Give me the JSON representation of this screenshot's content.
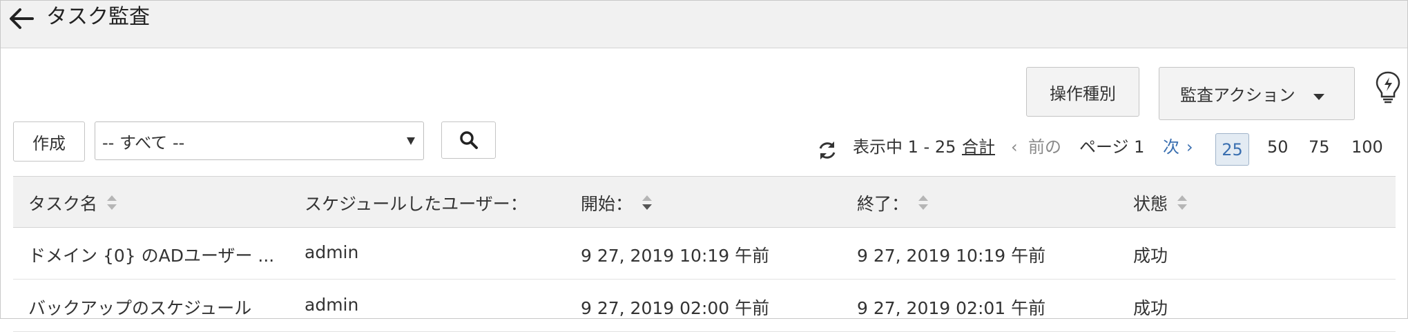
{
  "header": {
    "title": "タスク監査"
  },
  "toolbar": {
    "operation_type_label": "操作種別",
    "audit_action_label": "監査アクション",
    "create_label": "作成",
    "filter_value": "-- すべて --"
  },
  "pagination": {
    "showing_label": "表示中 1 - 25",
    "total_label": "合計",
    "prev_label": "前の",
    "page_label": "ページ 1",
    "next_label": "次",
    "sizes": [
      "25",
      "50",
      "75",
      "100"
    ],
    "active_size": "25"
  },
  "table": {
    "columns": [
      "タスク名",
      "スケジュールしたユーザー：",
      "開始：",
      "終了：",
      "状態"
    ],
    "rows": [
      {
        "name": "ドメイン {0} のADユーザー ...",
        "user": "admin",
        "start": "9 27, 2019 10:19 午前",
        "end": "9 27, 2019 10:19 午前",
        "status": "成功"
      },
      {
        "name": "バックアップのスケジュール",
        "user": "admin",
        "start": "9 27, 2019 02:00 午前",
        "end": "9 27, 2019 02:01 午前",
        "status": "成功"
      }
    ]
  },
  "colors": {
    "link_blue": "#3a6fb0",
    "header_bg": "#f1f1f1",
    "border": "#c4c4c4"
  },
  "icons": [
    "back-arrow-icon",
    "lightbulb-icon",
    "search-icon",
    "refresh-icon",
    "sort-icon"
  ]
}
